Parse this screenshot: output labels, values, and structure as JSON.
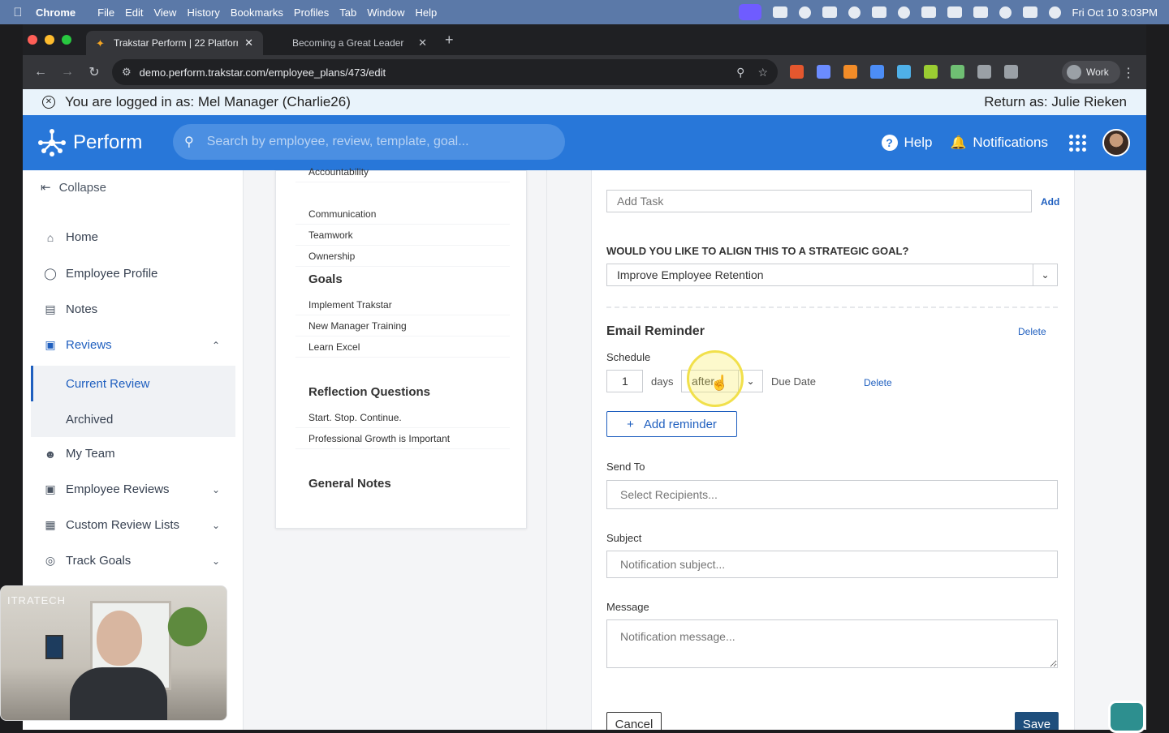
{
  "menubar": {
    "app": "Chrome",
    "items": [
      "File",
      "Edit",
      "View",
      "History",
      "Bookmarks",
      "Profiles",
      "Tab",
      "Window",
      "Help"
    ],
    "clock": "Fri Oct 10  3:03PM"
  },
  "browser": {
    "tabs": [
      {
        "title": "Trakstar Perform | 22 Platform",
        "active": true
      },
      {
        "title": "Becoming a Great Leader",
        "active": false
      }
    ],
    "url": "demo.perform.trakstar.com/employee_plans/473/edit",
    "profile": "Work"
  },
  "banner": {
    "logged_in": "You are logged in as: Mel Manager (Charlie26)",
    "return_as": "Return as: Julie Rieken"
  },
  "header": {
    "brand": "Perform",
    "search_placeholder": "Search by employee, review, template, goal...",
    "help": "Help",
    "notifications": "Notifications"
  },
  "sidebar": {
    "collapse": "Collapse",
    "home": "Home",
    "employee_profile": "Employee Profile",
    "notes": "Notes",
    "reviews": "Reviews",
    "current_review": "Current Review",
    "archived": "Archived",
    "my_team": "My Team",
    "employee_reviews": "Employee Reviews",
    "custom_review_lists": "Custom Review Lists",
    "track_goals": "Track Goals"
  },
  "mid": {
    "competencies": [
      "Accountability",
      "Communication",
      "Teamwork",
      "Ownership"
    ],
    "goals_title": "Goals",
    "goals": [
      "Implement Trakstar",
      "New Manager Training",
      "Learn Excel"
    ],
    "reflection_title": "Reflection Questions",
    "reflection": [
      "Start. Stop. Continue.",
      "Professional Growth is Important"
    ],
    "general_notes_title": "General Notes"
  },
  "form": {
    "add_task_placeholder": "Add Task",
    "add_label": "Add",
    "align_question": "WOULD YOU LIKE TO ALIGN THIS TO A STRATEGIC GOAL?",
    "strategic_goal": "Improve Employee Retention",
    "email_reminder_title": "Email Reminder",
    "delete": "Delete",
    "schedule_label": "Schedule",
    "schedule_days_value": "1",
    "days_label": "days",
    "timing_value": "after",
    "due_date_label": "Due Date",
    "add_reminder": "Add reminder",
    "send_to_label": "Send To",
    "send_to_placeholder": "Select Recipients...",
    "subject_label": "Subject",
    "subject_placeholder": "Notification subject...",
    "message_label": "Message",
    "message_placeholder": "Notification message...",
    "cancel": "Cancel",
    "save": "Save"
  },
  "webcam": {
    "sign_text": "ITRATECH"
  }
}
